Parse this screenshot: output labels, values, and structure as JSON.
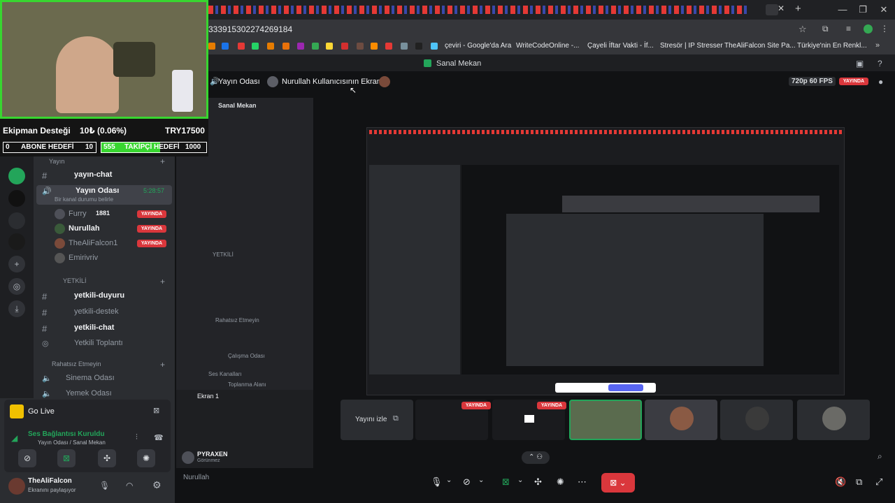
{
  "browser": {
    "url": "333915302274269184",
    "bookmarks": [
      "çeviri - Google'da Ara",
      "WriteCodeOnline -...",
      "Çayeli İftar Vakti - İf...",
      "Stresör | IP Stresser",
      "TheAliFalcon Site Pa...",
      "Türkiye'nin En Renkl..."
    ],
    "window_controls": [
      "—",
      "❐",
      "✕"
    ]
  },
  "app_title": "Sanal Mekan",
  "stream_bar": {
    "channel": "Yayın Odası",
    "screen_label": "Nurullah Kullanıcısının Ekranı",
    "quality": "720p 60 FPS",
    "live_badge": "YAYINDA"
  },
  "overlay": {
    "goal_name": "Ekipman Desteği",
    "goal_progress": "10₺ (0.06%)",
    "goal_target": "TRY17500",
    "sub_current": "0",
    "sub_label": "ABONE HEDEFİ",
    "sub_goal": "10",
    "follow_current": "555",
    "follow_label": "TAKİPÇİ HEDEFİ",
    "follow_goal": "1000"
  },
  "sidebar": {
    "category_yayin": "Yayın",
    "ch_yayin_chat": "yayın-chat",
    "voice_channel": "Yayın Odası",
    "voice_time": "5:28:57",
    "voice_status": "Bir kanal durumu belirle",
    "members": [
      {
        "name": "Furry",
        "extra": "1881",
        "badge": "YAYINDA"
      },
      {
        "name": "Nurullah",
        "extra": "",
        "badge": "YAYINDA"
      },
      {
        "name": "TheAliFalcon1",
        "extra": "",
        "badge": "YAYINDA"
      },
      {
        "name": "Emirivriv",
        "extra": "",
        "badge": ""
      }
    ],
    "category_yetkili": "YETKİLİ",
    "ch_duyuru": "yetkili-duyuru",
    "ch_destek": "yetkili-destek",
    "ch_chat": "yetkili-chat",
    "ch_toplanti": "Yetkili Toplantı",
    "category_rahatsiz": "Rahatsız Etmeyin",
    "ch_sinema": "Sinema Odası",
    "ch_yemek": "Yemek Odası"
  },
  "go_live": {
    "label": "Go Live"
  },
  "voice_panel": {
    "status": "Ses Bağlantısı Kuruldu",
    "path": "Yayın Odası / Sanal Mekan"
  },
  "user": {
    "name": "TheAliFalcon",
    "status": "Ekranını paylaşıyor"
  },
  "stage": {
    "follow_stream": "Yayını izle",
    "nested_channel": "Sanal Mekan",
    "nested_ekran": "Ekran 1",
    "nested_user": "PYRAXEN",
    "nested_user_status": "Görünmez",
    "nested_input_user": "Nurullah",
    "nested_stream_bar_live": "YAYINDA",
    "nested_yetkili": "YETKİLİ",
    "nested_rahatsiz": "Rahatsız Etmeyin",
    "nested_ses": "Ses Kanalları",
    "nested_toplanma": "Toplanma Alanı",
    "nested_calisma": "Çalışma Odası"
  },
  "colors": {
    "live_red": "#da373c",
    "green": "#23a55a",
    "webcam_border": "#38d630"
  }
}
